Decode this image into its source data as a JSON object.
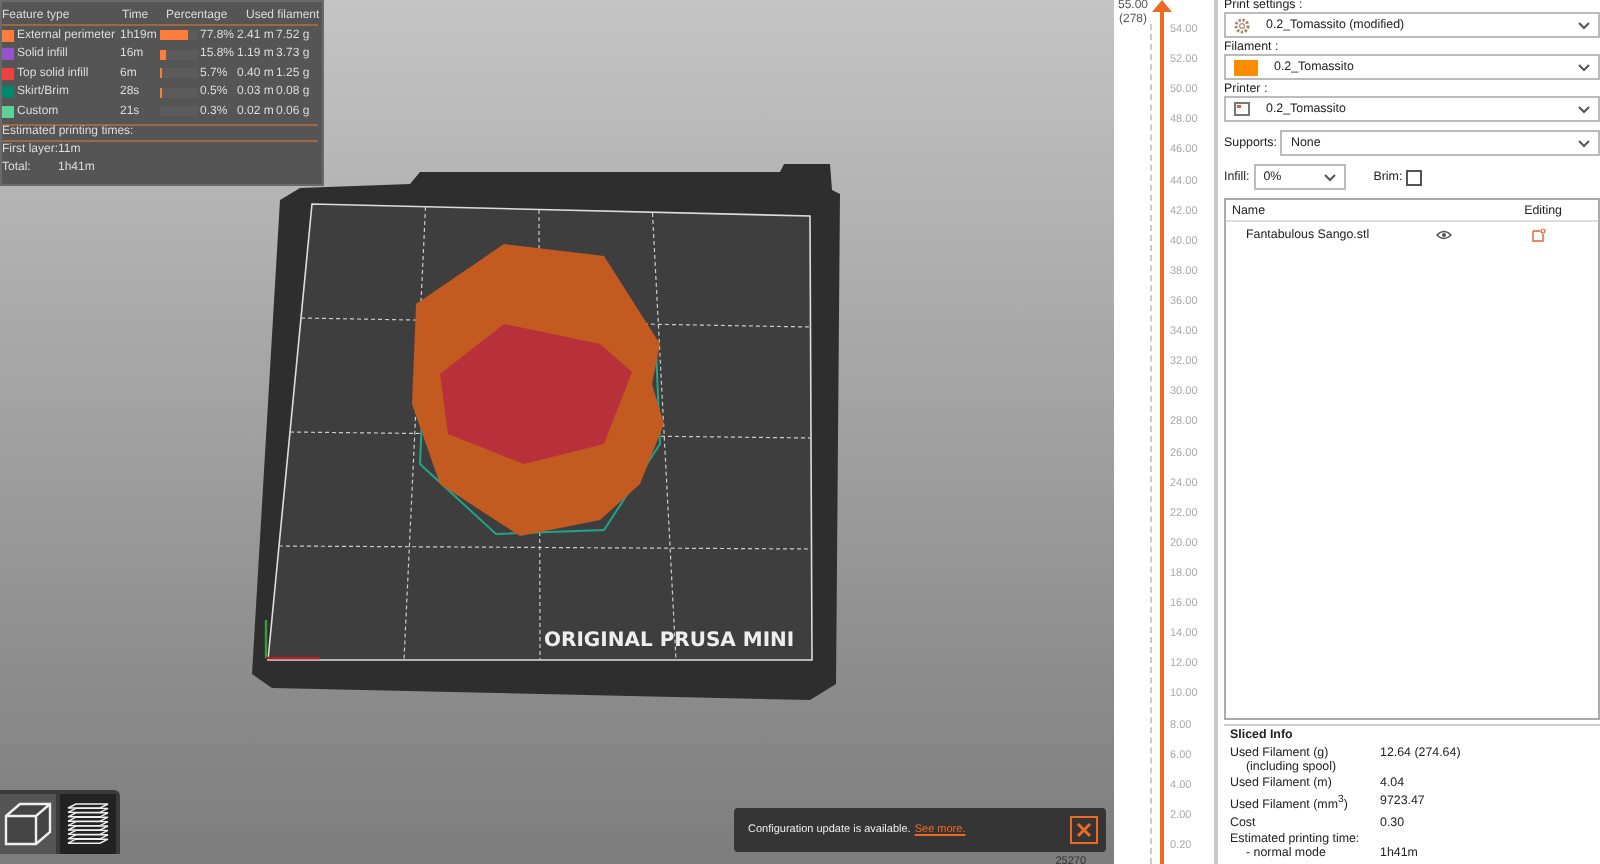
{
  "legend": {
    "columns": [
      "Feature type",
      "Time",
      "Percentage",
      "Used filament"
    ],
    "rows": [
      {
        "name": "External perimeter",
        "color": "#ff7d38",
        "time": "1h19m",
        "level": 0.778,
        "percentage": "77.8%",
        "length": "2.41 m",
        "weight": "7.52 g"
      },
      {
        "name": "Solid infill",
        "color": "#9654cc",
        "time": "16m",
        "level": 0.158,
        "percentage": "15.8%",
        "length": "1.19 m",
        "weight": "3.73 g"
      },
      {
        "name": "Top solid infill",
        "color": "#f04040",
        "time": "6m",
        "level": 0.057,
        "percentage": "5.7%",
        "length": "0.40 m",
        "weight": "1.25 g"
      },
      {
        "name": "Skirt/Brim",
        "color": "#00876e",
        "time": "28s",
        "level": 0.005,
        "percentage": "0.5%",
        "length": "0.03 m",
        "weight": "0.08 g"
      },
      {
        "name": "Custom",
        "color": "#5ed194",
        "time": "21s",
        "level": 0.003,
        "percentage": "0.3%",
        "length": "0.02 m",
        "weight": "0.06 g"
      }
    ],
    "times_title": "Estimated printing times:",
    "times": [
      {
        "label": "First layer:",
        "value": "11m"
      },
      {
        "label": "Total:",
        "value": "1h41m"
      }
    ]
  },
  "bed": {
    "label": "ORIGINAL PRUSA MINI"
  },
  "view_buttons": [
    {
      "kind": "model",
      "selected": false
    },
    {
      "kind": "layers",
      "selected": true
    }
  ],
  "notification": {
    "text": "Configuration update is available.",
    "link": "See more."
  },
  "layer_slider": {
    "top_value": "55.00",
    "top_layer": "(278)",
    "level": 1,
    "ticks": [
      "54.00",
      "52.00",
      "50.00",
      "48.00",
      "46.00",
      "44.00",
      "42.00",
      "40.00",
      "38.00",
      "36.00",
      "34.00",
      "32.00",
      "30.00",
      "28.00",
      "26.00",
      "24.00",
      "22.00",
      "20.00",
      "18.00",
      "16.00",
      "14.00",
      "12.00",
      "10.00",
      "8.00",
      "6.00",
      "4.00",
      "2.00",
      "0.20"
    ]
  },
  "bottom_reading": "25270",
  "sidebar": {
    "presets": [
      {
        "label": "Print settings :",
        "kind": "print",
        "value": "0.2_Tomassito (modified)"
      },
      {
        "label": "Filament :",
        "kind": "filament",
        "value": "0.2_Tomassito"
      },
      {
        "label": "Printer :",
        "kind": "printer",
        "value": "0.2_Tomassito"
      }
    ],
    "supports": {
      "label": "Supports:",
      "value": "None"
    },
    "infill": {
      "label": "Infill:",
      "value": "0%"
    },
    "brim": {
      "label": "Brim:",
      "checked": false
    },
    "objects": {
      "columns": [
        "Name",
        "Editing"
      ],
      "rows": [
        {
          "name": "Fantabulous Sango.stl"
        }
      ]
    },
    "sliced_info": {
      "title": "Sliced Info",
      "rows": [
        {
          "kind": "measure",
          "label": "Used Filament (g)",
          "sublabel": "(including spool)",
          "value": "12.64 (274.64)"
        },
        {
          "kind": "measure",
          "label": "Used Filament (m)",
          "value": "4.04"
        },
        {
          "kind": "measure",
          "label": "Used Filament (mm$^{3}$)",
          "value": "9723.47"
        },
        {
          "kind": "measure",
          "label": "Cost",
          "value": "0.30"
        },
        {
          "kind": "time",
          "label": "Estimated printing time:",
          "sublabel": "- normal mode",
          "value": "1h41m"
        }
      ]
    }
  }
}
